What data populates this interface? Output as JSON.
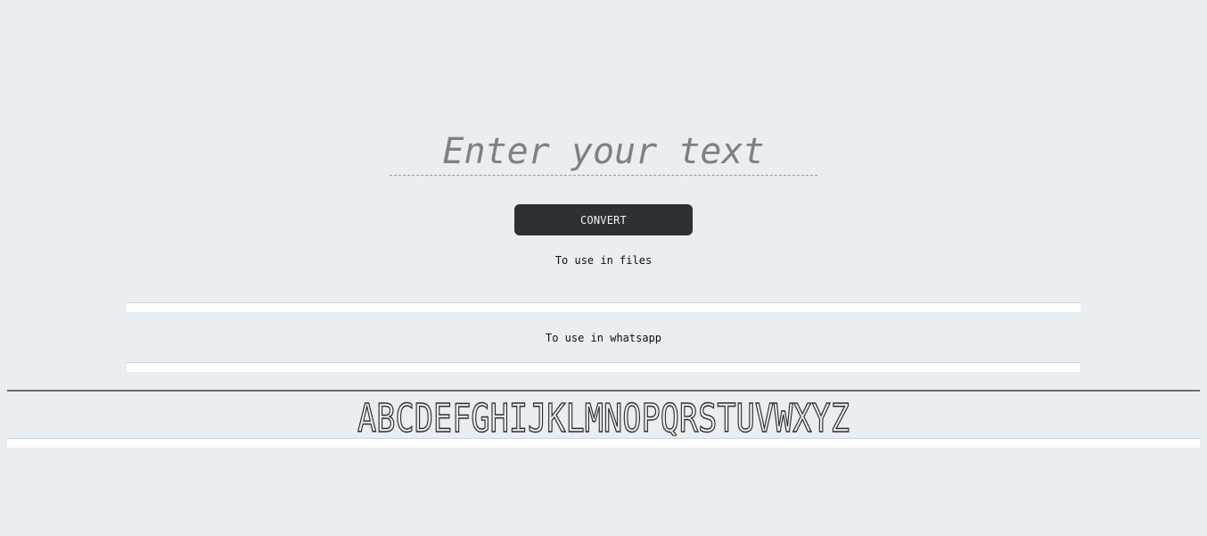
{
  "input": {
    "placeholder": "Enter your text",
    "value": ""
  },
  "convert_button": {
    "label": "CONVERT"
  },
  "files_section": {
    "label": "To use in files",
    "output": ""
  },
  "whatsapp_section": {
    "label": "To use in whatsapp",
    "output": ""
  },
  "font_preview": {
    "sample": "ABCDEFGHIJKLMNOPQRSTUVWXYZ"
  },
  "colors": {
    "background": "#e8eef1",
    "button": "#2b3134",
    "button_text": "#f2f4f5",
    "placeholder": "#7f8182",
    "divider": "#6a6e71"
  }
}
